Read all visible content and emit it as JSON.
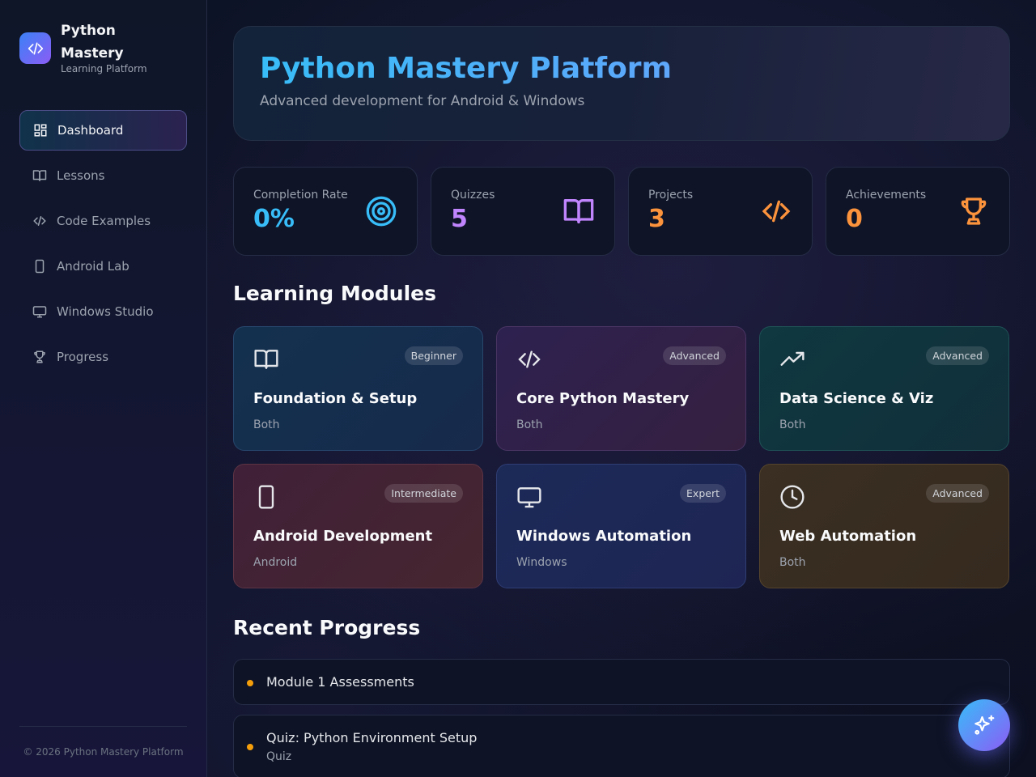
{
  "brand": {
    "name": "Python Mastery",
    "subtitle": "Learning Platform"
  },
  "sidebar": {
    "items": [
      {
        "label": "Dashboard",
        "icon": "grid-icon",
        "active": true
      },
      {
        "label": "Lessons",
        "icon": "book-icon"
      },
      {
        "label": "Code Examples",
        "icon": "code-icon"
      },
      {
        "label": "Android Lab",
        "icon": "smartphone-icon"
      },
      {
        "label": "Windows Studio",
        "icon": "monitor-icon"
      },
      {
        "label": "Progress",
        "icon": "trophy-icon"
      }
    ],
    "footer": "© 2026 Python Mastery Platform"
  },
  "hero": {
    "title": "Python Mastery Platform",
    "subtitle": "Advanced development for Android & Windows"
  },
  "stats": [
    {
      "label": "Completion Rate",
      "value": "0%",
      "icon": "target-icon",
      "color": "#38bdf8"
    },
    {
      "label": "Quizzes",
      "value": "5",
      "icon": "book-open-icon",
      "color": "#c084fc"
    },
    {
      "label": "Projects",
      "value": "3",
      "icon": "code-icon",
      "color": "#fb923c"
    },
    {
      "label": "Achievements",
      "value": "0",
      "icon": "trophy-icon",
      "color": "#fb923c"
    }
  ],
  "modules_section": {
    "title": "Learning Modules"
  },
  "modules": [
    {
      "title": "Foundation & Setup",
      "level": "Beginner",
      "platform": "Both",
      "icon": "book-open-icon"
    },
    {
      "title": "Core Python Mastery",
      "level": "Advanced",
      "platform": "Both",
      "icon": "code-icon"
    },
    {
      "title": "Data Science & Viz",
      "level": "Advanced",
      "platform": "Both",
      "icon": "trending-up-icon"
    },
    {
      "title": "Android Development",
      "level": "Intermediate",
      "platform": "Android",
      "icon": "smartphone-icon"
    },
    {
      "title": "Windows Automation",
      "level": "Expert",
      "platform": "Windows",
      "icon": "monitor-icon"
    },
    {
      "title": "Web Automation",
      "level": "Advanced",
      "platform": "Both",
      "icon": "clock-icon"
    }
  ],
  "progress_section": {
    "title": "Recent Progress"
  },
  "progress": [
    {
      "title": "Module 1 Assessments",
      "sub": ""
    },
    {
      "title": "Quiz: Python Environment Setup",
      "sub": "Quiz"
    }
  ],
  "fab": {
    "icon": "sparkles-icon"
  }
}
